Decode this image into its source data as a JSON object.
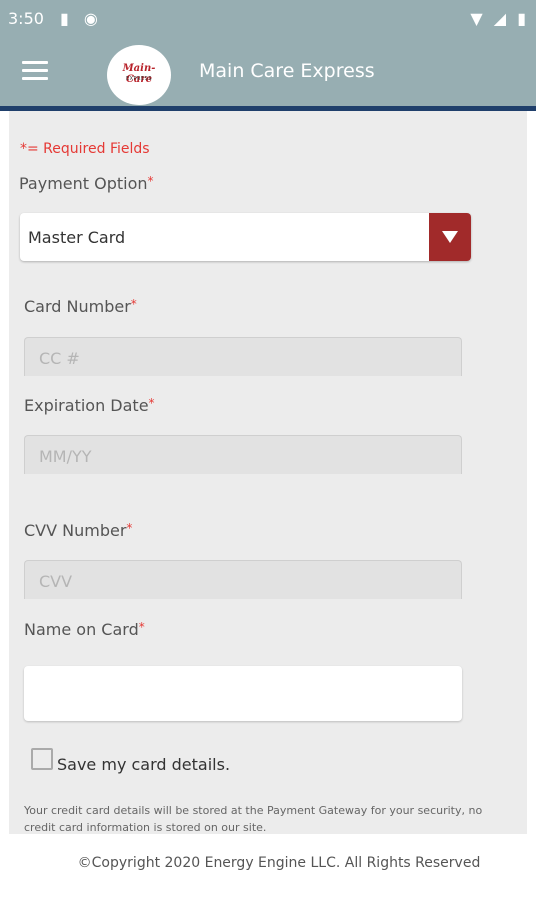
{
  "status_bar": {
    "time": "3:50",
    "left_icons": [
      "sd-card-icon",
      "sync-icon"
    ],
    "right_icons": [
      "wifi-icon",
      "signal-icon",
      "battery-icon"
    ]
  },
  "app_bar": {
    "title": "Main Care Express",
    "logo_main": "Main-Care",
    "logo_sub": "EXPRESS"
  },
  "form": {
    "required_note": "*= Required Fields",
    "payment_option_label": "Payment Option",
    "payment_option_value": "Master Card",
    "card_number_label": "Card Number",
    "card_number_placeholder": "CC #",
    "expiration_label": "Expiration Date",
    "expiration_placeholder": "MM/YY",
    "cvv_label": "CVV Number",
    "cvv_placeholder": "CVV",
    "name_label": "Name on Card",
    "name_value": "",
    "save_card_label": "Save my card details.",
    "save_card_checked": false,
    "storage_note": "Your credit card details will be stored at the Payment Gateway for your security, no credit card information is stored on our site.",
    "required_star": "*"
  },
  "footer": {
    "copyright": "©Copyright 2020 Energy Engine LLC. All Rights Reserved"
  },
  "colors": {
    "app_bar": "#97aeb2",
    "app_bar_border": "#1f3f6b",
    "accent_red": "#a12a2a",
    "required_red": "#e53935"
  }
}
